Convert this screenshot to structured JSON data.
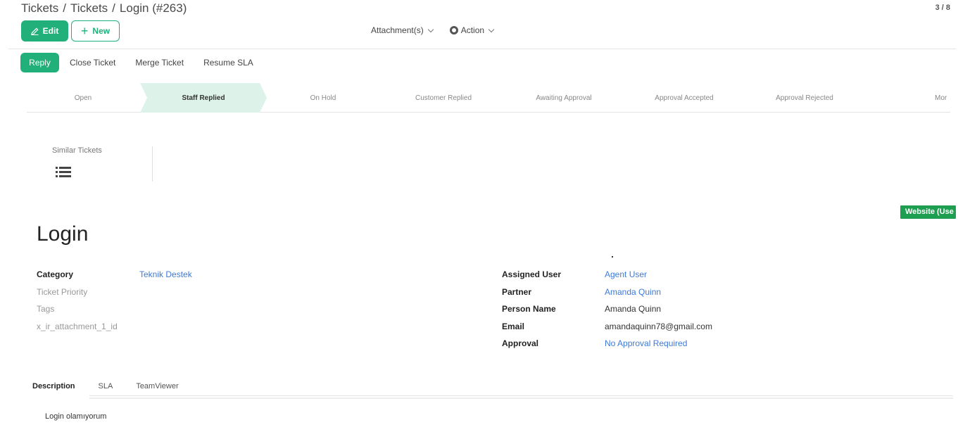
{
  "breadcrumb": {
    "items": [
      "Tickets",
      "Tickets",
      "Login (#263)"
    ],
    "sep": "/"
  },
  "pager": "3 / 8",
  "buttons": {
    "edit": "Edit",
    "new": "New"
  },
  "toolbar": {
    "attachments": "Attachment(s)",
    "action": "Action"
  },
  "actions": {
    "reply": "Reply",
    "close": "Close Ticket",
    "merge": "Merge Ticket",
    "resume": "Resume SLA"
  },
  "stages": [
    {
      "label": "Open",
      "active": false
    },
    {
      "label": "Staff Replied",
      "active": true
    },
    {
      "label": "On Hold",
      "active": false
    },
    {
      "label": "Customer Replied",
      "active": false
    },
    {
      "label": "Awaiting Approval",
      "active": false
    },
    {
      "label": "Approval Accepted",
      "active": false
    },
    {
      "label": "Approval Rejected",
      "active": false
    },
    {
      "label": "Mor",
      "active": false
    }
  ],
  "similar_tickets": {
    "label": "Similar Tickets"
  },
  "badge": "Website (Use",
  "ticket": {
    "title": "Login",
    "left_fields": [
      {
        "label": "Category",
        "value": "Teknik Destek",
        "muted": false,
        "link": true
      },
      {
        "label": "Ticket Priority",
        "value": "",
        "muted": true,
        "link": false
      },
      {
        "label": "Tags",
        "value": "",
        "muted": true,
        "link": false
      },
      {
        "label": "x_ir_attachment_1_id",
        "value": "",
        "muted": true,
        "link": false
      }
    ],
    "right_fields": [
      {
        "label": "Assigned User",
        "value": "Agent User",
        "link": true
      },
      {
        "label": "Partner",
        "value": "Amanda Quinn",
        "link": true
      },
      {
        "label": "Person Name",
        "value": "Amanda Quinn",
        "link": false
      },
      {
        "label": "Email",
        "value": "amandaquinn78@gmail.com",
        "link": false
      },
      {
        "label": "Approval",
        "value": "No Approval Required",
        "link": true
      }
    ]
  },
  "tabs": [
    {
      "label": "Description",
      "active": true
    },
    {
      "label": "SLA",
      "active": false
    },
    {
      "label": "TeamViewer",
      "active": false
    }
  ],
  "description": "Login olamıyorum",
  "colors": {
    "primary": "#21b07a",
    "badge": "#1e9e50",
    "link": "#3d7ad6",
    "stage_active": "#ddf3ea"
  }
}
